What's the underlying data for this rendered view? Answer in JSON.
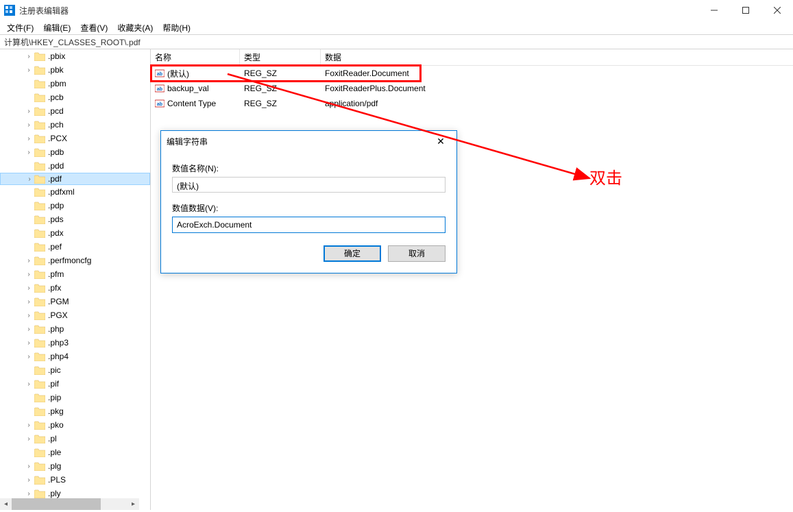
{
  "window": {
    "title": "注册表编辑器"
  },
  "menu": {
    "file": "文件(F)",
    "edit": "编辑(E)",
    "view": "查看(V)",
    "favorites": "收藏夹(A)",
    "help": "帮助(H)"
  },
  "addressbar": {
    "path": "计算机\\HKEY_CLASSES_ROOT\\.pdf"
  },
  "tree": {
    "items": [
      {
        "label": ".pbix",
        "expandable": true
      },
      {
        "label": ".pbk",
        "expandable": true
      },
      {
        "label": ".pbm",
        "expandable": false
      },
      {
        "label": ".pcb",
        "expandable": false
      },
      {
        "label": ".pcd",
        "expandable": true
      },
      {
        "label": ".pch",
        "expandable": true
      },
      {
        "label": ".PCX",
        "expandable": true
      },
      {
        "label": ".pdb",
        "expandable": true
      },
      {
        "label": ".pdd",
        "expandable": false
      },
      {
        "label": ".pdf",
        "expandable": true,
        "selected": true
      },
      {
        "label": ".pdfxml",
        "expandable": false
      },
      {
        "label": ".pdp",
        "expandable": false
      },
      {
        "label": ".pds",
        "expandable": false
      },
      {
        "label": ".pdx",
        "expandable": false
      },
      {
        "label": ".pef",
        "expandable": false
      },
      {
        "label": ".perfmoncfg",
        "expandable": true
      },
      {
        "label": ".pfm",
        "expandable": true
      },
      {
        "label": ".pfx",
        "expandable": true
      },
      {
        "label": ".PGM",
        "expandable": true
      },
      {
        "label": ".PGX",
        "expandable": true
      },
      {
        "label": ".php",
        "expandable": true
      },
      {
        "label": ".php3",
        "expandable": true
      },
      {
        "label": ".php4",
        "expandable": true
      },
      {
        "label": ".pic",
        "expandable": false
      },
      {
        "label": ".pif",
        "expandable": true
      },
      {
        "label": ".pip",
        "expandable": false
      },
      {
        "label": ".pkg",
        "expandable": false
      },
      {
        "label": ".pko",
        "expandable": true
      },
      {
        "label": ".pl",
        "expandable": true
      },
      {
        "label": ".ple",
        "expandable": false
      },
      {
        "label": ".plg",
        "expandable": true
      },
      {
        "label": ".PLS",
        "expandable": true
      },
      {
        "label": ".ply",
        "expandable": true
      }
    ]
  },
  "list": {
    "cols": {
      "name": "名称",
      "type": "类型",
      "data": "数据"
    },
    "rows": [
      {
        "name": "(默认)",
        "type": "REG_SZ",
        "data": "FoxitReader.Document",
        "highlight": true
      },
      {
        "name": "backup_val",
        "type": "REG_SZ",
        "data": "FoxitReaderPlus.Document"
      },
      {
        "name": "Content Type",
        "type": "REG_SZ",
        "data": "application/pdf"
      }
    ]
  },
  "dialog": {
    "title": "编辑字符串",
    "name_label": "数值名称(N):",
    "name_value": "(默认)",
    "data_label": "数值数据(V):",
    "data_value": "AcroExch.Document",
    "ok": "确定",
    "cancel": "取消"
  },
  "annotation": {
    "label": "双击"
  }
}
